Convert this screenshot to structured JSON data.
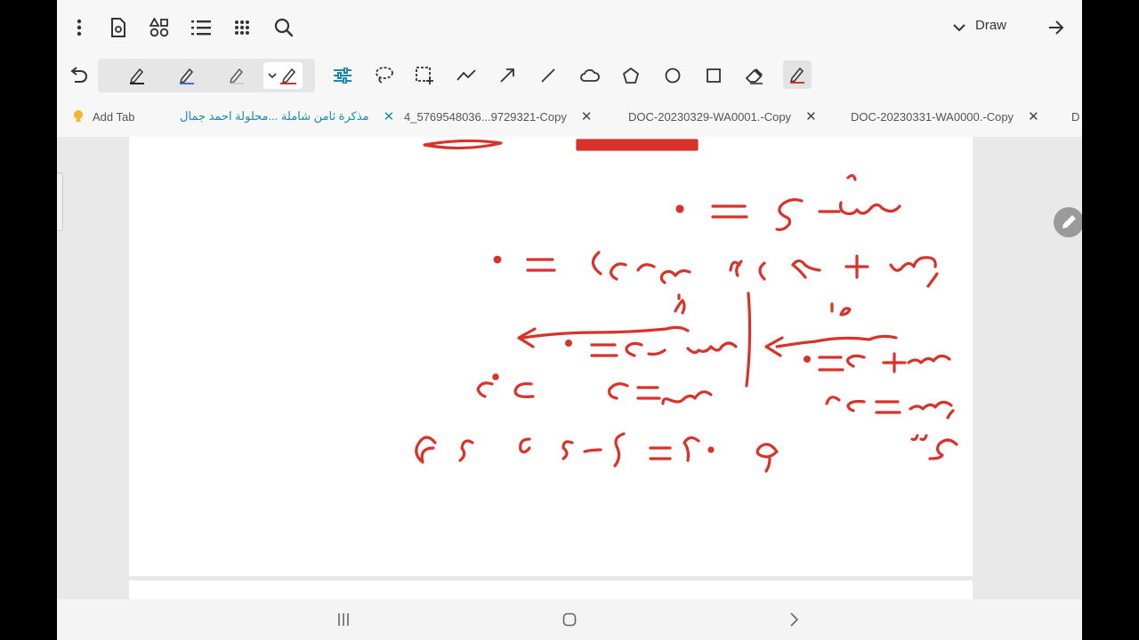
{
  "toolbar": {
    "draw_label": "Draw",
    "icons": [
      "more-icon",
      "page-settings-icon",
      "shapes-icon",
      "list-icon",
      "apps-grid-icon",
      "search-icon"
    ]
  },
  "tabs": [
    {
      "label": "Add Tab"
    },
    {
      "label": "مذكرة ثامن شاملة ...محلولة احمد جمال",
      "active": true
    },
    {
      "label": "4_5769548036...9729321-Copy"
    },
    {
      "label": "DOC-20230329-WA0001.-Copy"
    },
    {
      "label": "DOC-20230331-WA0000.-Copy"
    },
    {
      "label": "D"
    }
  ],
  "colors": {
    "ink": "#d9322b",
    "accent": "#1a8bb0",
    "pen_red": "#d9322b",
    "pen_blue": "#3a6fd8",
    "pen_black": "#222222"
  }
}
